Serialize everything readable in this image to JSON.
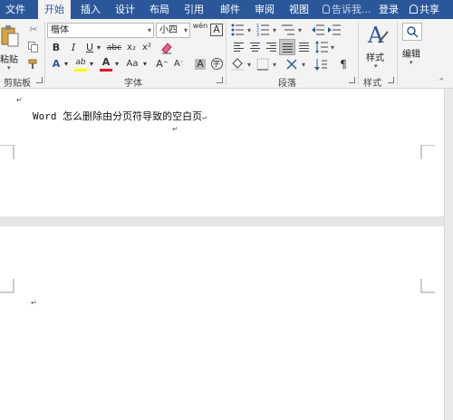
{
  "tabs": [
    {
      "label": "文件",
      "active": false
    },
    {
      "label": "开始",
      "active": true
    },
    {
      "label": "插入",
      "active": false
    },
    {
      "label": "设计",
      "active": false
    },
    {
      "label": "布局",
      "active": false
    },
    {
      "label": "引用",
      "active": false
    },
    {
      "label": "邮件",
      "active": false
    },
    {
      "label": "审阅",
      "active": false
    },
    {
      "label": "视图",
      "active": false
    }
  ],
  "tell_me": "告诉我...",
  "login": "登录",
  "share": "共享",
  "ribbon": {
    "clipboard": {
      "paste_label": "粘贴",
      "group_label": "剪贴板"
    },
    "font": {
      "font_name": "楷体",
      "font_size": "小四",
      "wen_label": "wén",
      "A_label": "A",
      "bold": "B",
      "italic": "I",
      "underline": "U",
      "strike": "abc",
      "subscript": "x₂",
      "superscript": "x²",
      "text_effect": "A",
      "highlight": "ab",
      "font_color": "A",
      "change_case": "Aa",
      "grow": "A",
      "shrink": "A",
      "char_border": "A",
      "enclose": "字",
      "group_label": "字体"
    },
    "paragraph": {
      "group_label": "段落"
    },
    "styles": {
      "label": "样式",
      "group_label": "样式"
    },
    "editing": {
      "label": "编辑"
    }
  },
  "document": {
    "title_text": "Word 怎么删除由分页符导致的空白页",
    "para_mark": "↵"
  },
  "colors": {
    "accent": "#2b579a",
    "ribbon_bg": "#f3f3f3",
    "highlight": "#ffff00",
    "font_color": "#e81123"
  }
}
